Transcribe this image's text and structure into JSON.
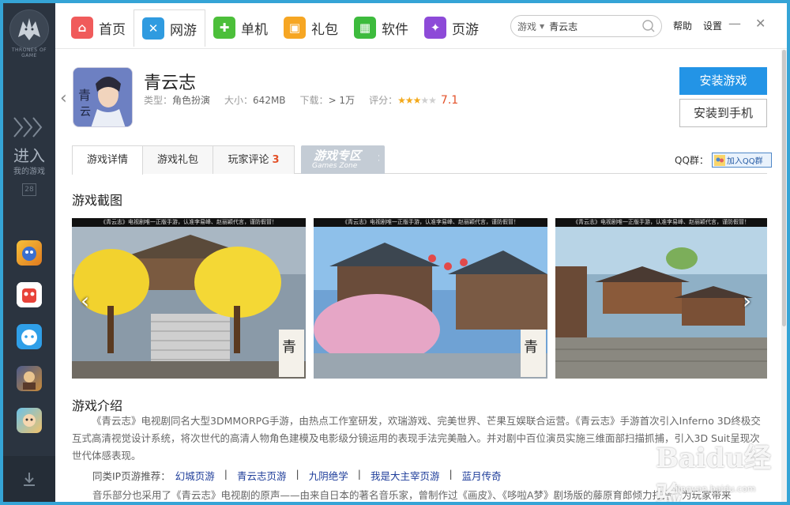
{
  "sidebar": {
    "logo_text": "THRONES OF GAME",
    "enter_label": "进入",
    "enter_sub": "我的游戏",
    "enter_count": "28"
  },
  "nav": {
    "items": [
      {
        "label": "首页",
        "icon": "home-icon",
        "color": "#f05b5b"
      },
      {
        "label": "网游",
        "icon": "swords-icon",
        "color": "#2f9be0"
      },
      {
        "label": "单机",
        "icon": "gamepad-icon",
        "color": "#4cbf3a"
      },
      {
        "label": "礼包",
        "icon": "gift-icon",
        "color": "#f6a623"
      },
      {
        "label": "软件",
        "icon": "grid-icon",
        "color": "#3dbb3d"
      },
      {
        "label": "页游",
        "icon": "star-icon",
        "color": "#8d4ad8"
      }
    ],
    "search_scope": "游戏",
    "search_value": "青云志",
    "help": "帮助",
    "settings": "设置"
  },
  "game": {
    "title": "青云志",
    "type_label": "类型：",
    "type_value": "角色扮演",
    "size_label": "大小：",
    "size_value": "642MB",
    "downloads_label": "下载：",
    "downloads_value": "> 1万",
    "rating_label": "评分：",
    "rating_stars": 3,
    "rating_score": "7.1",
    "install_button": "安装游戏",
    "install_phone_button": "安装到手机"
  },
  "tabs": {
    "details": "游戏详情",
    "gifts": "游戏礼包",
    "comments": "玩家评论",
    "comments_count": "3",
    "zone_cn": "游戏专区",
    "zone_en": "Games Zone",
    "qq_label": "QQ群：",
    "qq_button": "加入QQ群"
  },
  "screenshots": {
    "title": "游戏截图",
    "banner": "《青云志》电视剧唯一正版手游，认准李易峰、赵丽颖代言，谨防假冒！"
  },
  "intro": {
    "title": "游戏介绍",
    "paragraph": "《青云志》电视剧同名大型3DMMORPG手游，由热点工作室研发，欢瑞游戏、完美世界、芒果互娱联合运营。《青云志》手游首次引入Inferno 3D终极交互式高清视觉设计系统，将次世代的高清人物角色建模及电影级分镜运用的表现手法完美融入。并对剧中百位演员实施三维面部扫描抓捕，引入3D Suit呈现次世代体感表现。",
    "rec_label": "同类IP页游推荐：",
    "rec_links": [
      "幻城页游",
      "青云志页游",
      "九阴绝学",
      "我是大主宰页游",
      "蓝月传奇"
    ],
    "more": "音乐部分也采用了《青云志》电视剧的原声——由来自日本的著名音乐家，曾制作过《画皮》、《哆啦A梦》剧场版的藤原育郎倾力打造，为玩家带来"
  },
  "watermark": {
    "brand": "Baidu经验",
    "url": "jingyan.baidu.com"
  }
}
